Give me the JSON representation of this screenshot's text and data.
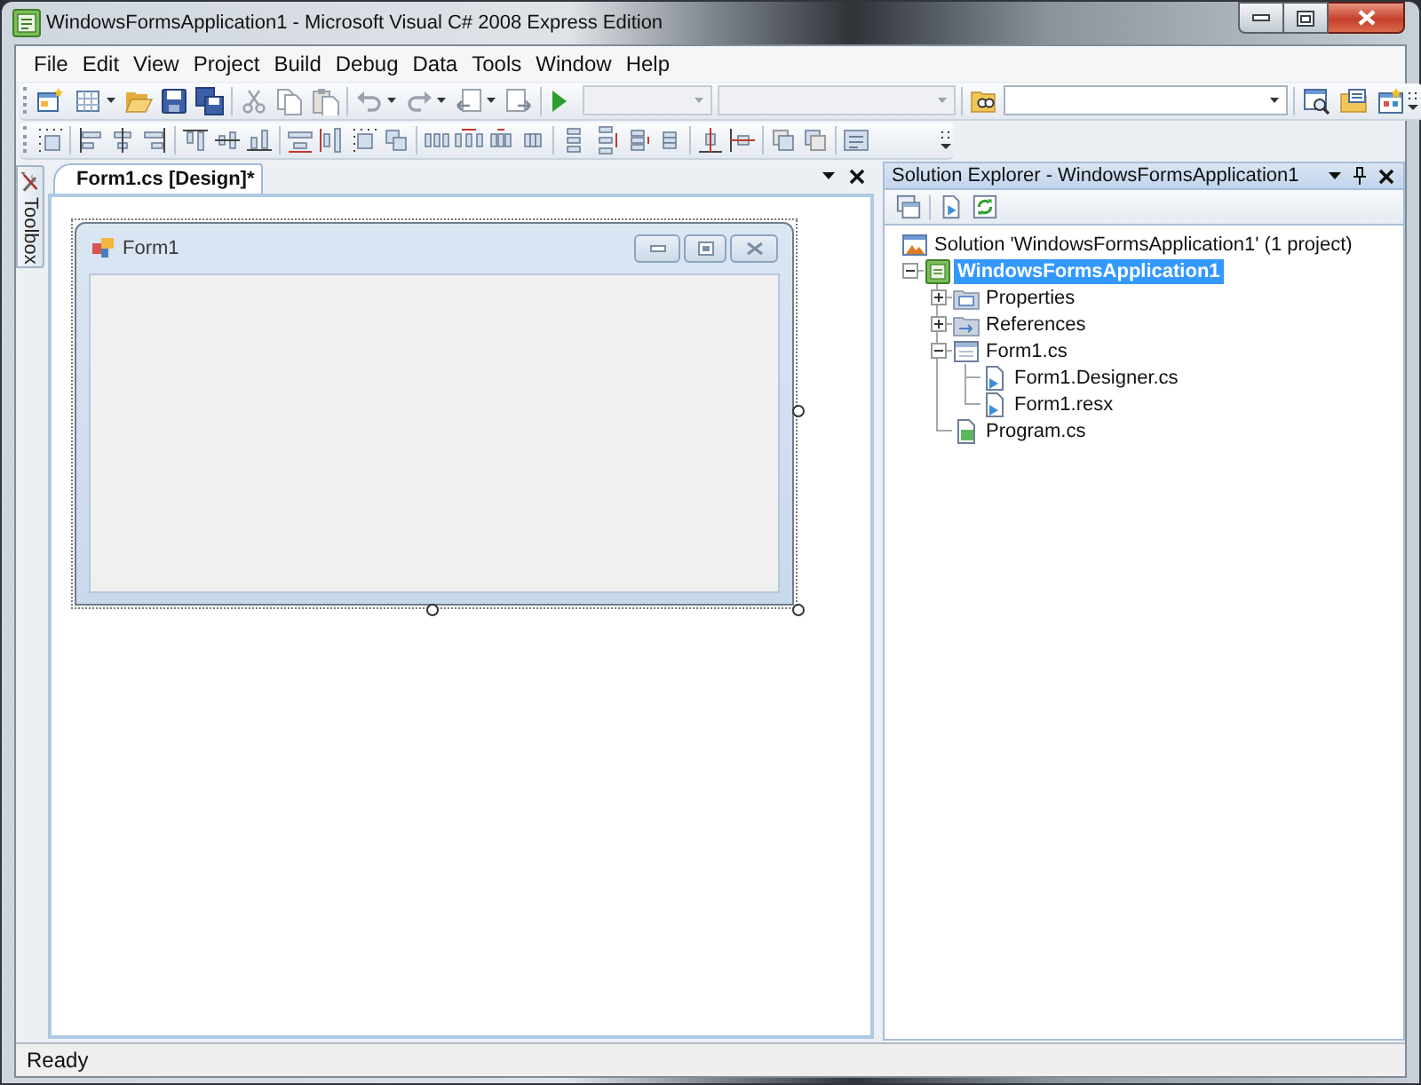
{
  "window": {
    "title": "WindowsFormsApplication1 - Microsoft Visual C# 2008 Express Edition"
  },
  "menu_bar": [
    {
      "label": "File"
    },
    {
      "label": "Edit"
    },
    {
      "label": "View"
    },
    {
      "label": "Project"
    },
    {
      "label": "Build"
    },
    {
      "label": "Debug"
    },
    {
      "label": "Data"
    },
    {
      "label": "Tools"
    },
    {
      "label": "Window"
    },
    {
      "label": "Help"
    }
  ],
  "toolbar": {
    "combos": [
      {
        "disabled": true
      },
      {
        "disabled": true
      },
      {
        "disabled": false
      }
    ]
  },
  "toolbox_tab": {
    "label": "Toolbox"
  },
  "document_tabs": [
    {
      "label": "Form1.cs [Design]*",
      "selected": true
    }
  ],
  "designer": {
    "form": {
      "title": "Form1"
    }
  },
  "solution_explorer": {
    "title": "Solution Explorer - WindowsFormsApplication1",
    "tree": [
      {
        "kind": "solution",
        "label": "Solution 'WindowsFormsApplication1' (1 project)",
        "selected": false,
        "children": [
          {
            "kind": "project",
            "label": "WindowsFormsApplication1",
            "selected": true,
            "expanded": true,
            "children": [
              {
                "kind": "properties",
                "label": "Properties",
                "selected": false,
                "expanded": false
              },
              {
                "kind": "references",
                "label": "References",
                "selected": false,
                "expanded": false
              },
              {
                "kind": "form",
                "label": "Form1.cs",
                "selected": false,
                "expanded": true,
                "children": [
                  {
                    "kind": "file",
                    "label": "Form1.Designer.cs",
                    "selected": false
                  },
                  {
                    "kind": "file",
                    "label": "Form1.resx",
                    "selected": false
                  }
                ]
              },
              {
                "kind": "code_file",
                "label": "Program.cs",
                "selected": false
              }
            ]
          }
        ]
      }
    ]
  },
  "status_bar": {
    "text": "Ready"
  }
}
